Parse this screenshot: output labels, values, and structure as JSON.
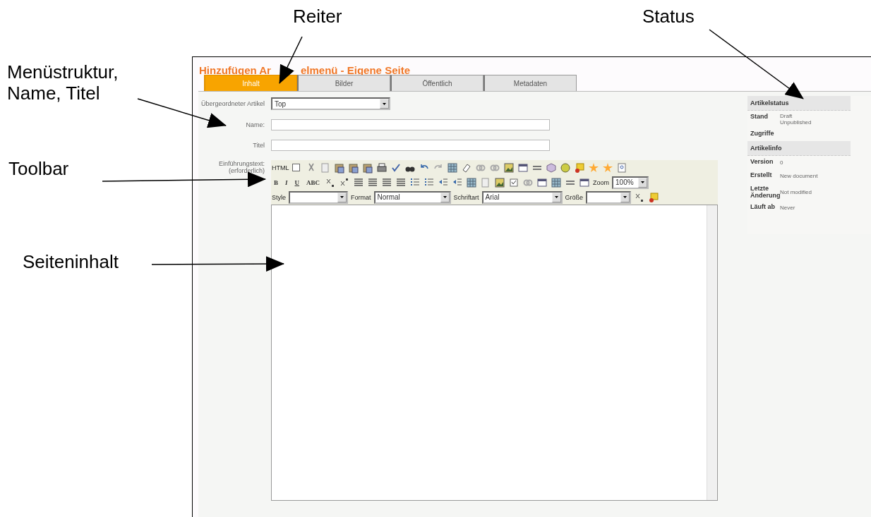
{
  "annotations": [
    {
      "lines": [
        "Reiter"
      ]
    },
    {
      "lines": [
        "Status"
      ]
    },
    {
      "lines": [
        "Menüstruktur,",
        "Name, Titel"
      ]
    },
    {
      "lines": [
        "Toolbar"
      ]
    },
    {
      "lines": [
        "Seiteninhalt"
      ]
    }
  ],
  "page_title": [
    "Hinzufügen Ar",
    "elmenü - Eigene Seite"
  ],
  "tabs": [
    {
      "label": "Inhalt",
      "selected": true
    },
    {
      "label": "Bilder",
      "selected": false
    },
    {
      "label": "Öffentlich",
      "selected": false
    },
    {
      "label": "Metadaten",
      "selected": false
    }
  ],
  "fields": [
    {
      "label": "Übergeordneter Artikel",
      "kind": "select",
      "value": "Top"
    },
    {
      "label": "Name:",
      "kind": "text"
    },
    {
      "label": "Titel",
      "kind": "text"
    }
  ],
  "editor": {
    "label": "Einführungstext: (erforderlich)",
    "html_label": "HTML",
    "html_checked": false,
    "format_buttons": [
      "B",
      "I",
      "U",
      "ABC"
    ],
    "zoom_label": "Zoom",
    "zoom": "100%",
    "dropdowns": [
      {
        "label": "Style"
      },
      {
        "label": "Format",
        "value": "Normal"
      },
      {
        "label": "Schriftart",
        "value": "Arial"
      },
      {
        "label": "Größe"
      }
    ]
  },
  "status": [
    {
      "title": "Artikelstatus",
      "rows": [
        {
          "label": "Stand",
          "values": [
            "Draft",
            "Unpublished"
          ]
        },
        {
          "label": "Zugriffe",
          "values": []
        }
      ]
    },
    {
      "title": "Artikelinfo",
      "rows": [
        {
          "label": "Version",
          "values": [
            "0"
          ]
        },
        {
          "label": "Erstellt",
          "values": [
            "New document"
          ]
        },
        {
          "label": "Letzte Änderung",
          "values": [
            "Not modified"
          ]
        },
        {
          "label": "Läuft ab",
          "values": [
            "Never"
          ]
        }
      ]
    }
  ]
}
